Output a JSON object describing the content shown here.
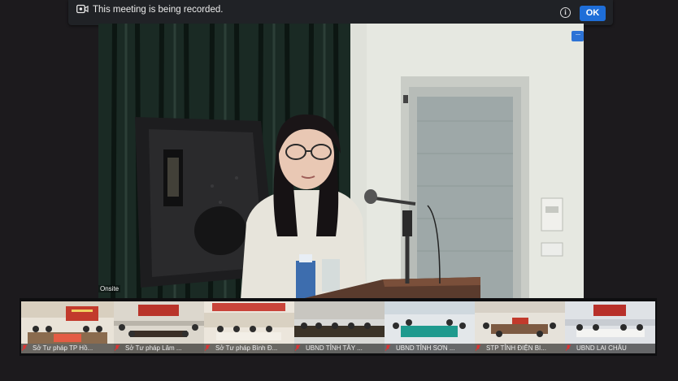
{
  "banner": {
    "text": "This meeting is being recorded.",
    "ok_label": "OK",
    "info_glyph": "i",
    "icons": [
      "record-icon",
      "info-icon"
    ]
  },
  "main_video": {
    "name_label": "Onsite",
    "more_glyph": "···"
  },
  "thumbnails": [
    {
      "label": "Sở Tư pháp TP Hồ..."
    },
    {
      "label": "Sở Tư pháp Lâm ..."
    },
    {
      "label": "Sở Tư pháp Bình Đ..."
    },
    {
      "label": "UBND TỈNH TÂY ..."
    },
    {
      "label": "UBND TỈNH SƠN ..."
    },
    {
      "label": "STP TỈNH ĐIỆN BI..."
    },
    {
      "label": "UBND LAI CHÂU"
    }
  ],
  "colors": {
    "accent": "#1e6ed8",
    "muted_mic": "#e03030"
  }
}
